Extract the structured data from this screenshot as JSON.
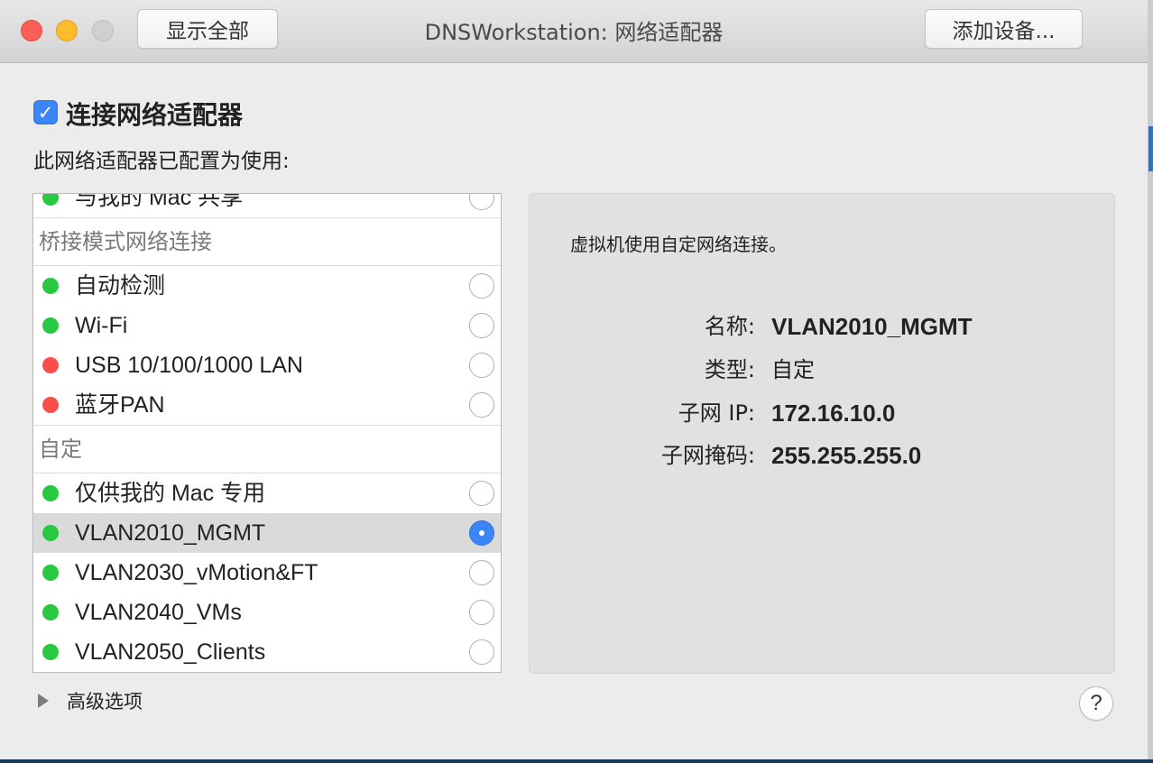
{
  "window": {
    "title": "DNSWorkstation: 网络适配器",
    "show_all_label": "显示全部",
    "add_device_label": "添加设备..."
  },
  "connect": {
    "checkbox_checked": true,
    "checkbox_glyph": "✓",
    "label": "连接网络适配器"
  },
  "description": "此网络适配器已配置为使用:",
  "list": {
    "partial_item": {
      "label": "与我的 Mac 共享",
      "status": "green"
    },
    "groups": [
      {
        "label": "桥接模式网络连接",
        "items": [
          {
            "label": "自动检测",
            "status": "green",
            "selected": false
          },
          {
            "label": "Wi-Fi",
            "status": "green",
            "selected": false
          },
          {
            "label": "USB 10/100/1000 LAN",
            "status": "red",
            "selected": false
          },
          {
            "label": "蓝牙PAN",
            "status": "red",
            "selected": false
          }
        ]
      },
      {
        "label": "自定",
        "items": [
          {
            "label": "仅供我的 Mac 专用",
            "status": "green",
            "selected": false
          },
          {
            "label": "VLAN2010_MGMT",
            "status": "green",
            "selected": true
          },
          {
            "label": "VLAN2030_vMotion&FT",
            "status": "green",
            "selected": false
          },
          {
            "label": "VLAN2040_VMs",
            "status": "green",
            "selected": false
          },
          {
            "label": "VLAN2050_Clients",
            "status": "green",
            "selected": false
          }
        ]
      }
    ]
  },
  "details": {
    "description": "虚拟机使用自定网络连接。",
    "name_key": "名称:",
    "name_value": "VLAN2010_MGMT",
    "type_key": "类型:",
    "type_value": "自定",
    "subnet_key": "子网 IP:",
    "subnet_value": "172.16.10.0",
    "mask_key": "子网掩码:",
    "mask_value": "255.255.255.0"
  },
  "advanced": {
    "label": "高级选项"
  },
  "help": {
    "label": "?"
  },
  "colors": {
    "accent": "#3b86f7",
    "status_green": "#28c840",
    "status_red": "#fb4d4a"
  }
}
